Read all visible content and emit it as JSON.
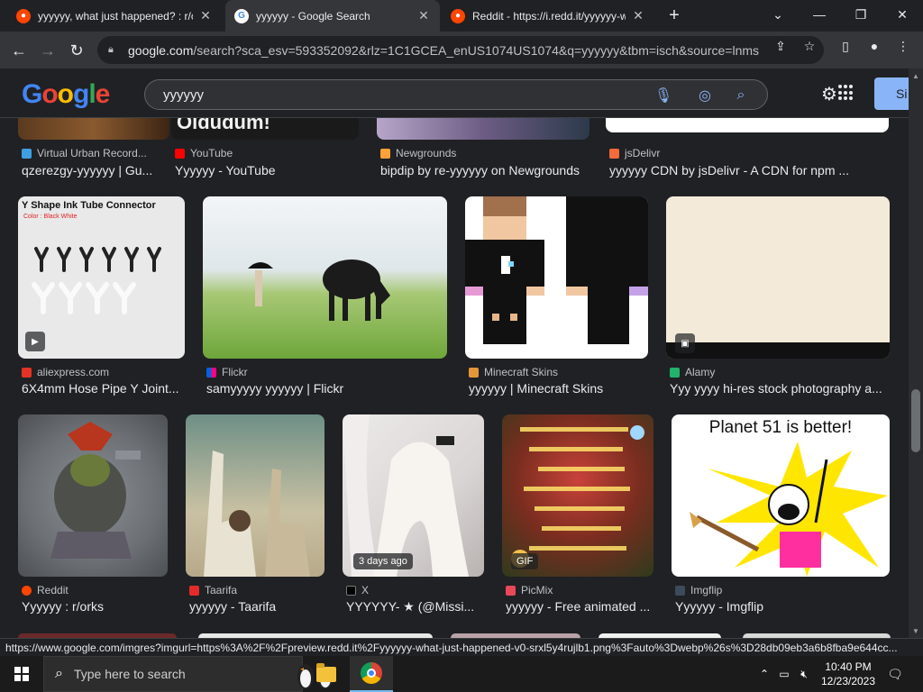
{
  "tabs": [
    {
      "title": "yyyyyy, what just happened? : r/c",
      "favicon": "reddit-icon",
      "active": false
    },
    {
      "title": "yyyyyy - Google Search",
      "favicon": "google-icon",
      "active": true
    },
    {
      "title": "Reddit - https://i.redd.it/yyyyyy-w",
      "favicon": "reddit-icon",
      "active": false
    }
  ],
  "toolbar": {
    "url_host": "google.com",
    "url_rest": "/search?sca_esv=593352092&rlz=1C1GCEA_enUS1074US1074&q=yyyyyy&tbm=isch&source=lnms..."
  },
  "google": {
    "logo_letters": [
      "G",
      "o",
      "o",
      "g",
      "l",
      "e"
    ],
    "query": "yyyyyy",
    "signin_label": "Si"
  },
  "results": {
    "row0": [
      {
        "source": "Virtual Urban Record...",
        "title": "qzerezgy-yyyyyy | Gu...",
        "thumb_text": ""
      },
      {
        "source": "YouTube",
        "title": "Yyyyyy - YouTube",
        "thumb_text": "Oldudum!"
      },
      {
        "source": "Newgrounds",
        "title": "bipdip by re-yyyyyy on Newgrounds",
        "thumb_text": ""
      },
      {
        "source": "jsDelivr",
        "title": "yyyyyy CDN by jsDelivr - A CDN for npm ...",
        "thumb_text": ""
      }
    ],
    "row1": [
      {
        "source": "aliexpress.com",
        "title": "6X4mm Hose Pipe Y Joint...",
        "thumb_text": "Y Shape Ink Tube Connector",
        "thumb_sub": "Color : Black White"
      },
      {
        "source": "Flickr",
        "title": "samyyyyy yyyyyy | Flickr"
      },
      {
        "source": "Minecraft Skins",
        "title": "yyyyyy | Minecraft Skins"
      },
      {
        "source": "Alamy",
        "title": "Yyy yyyy hi-res stock photography a..."
      }
    ],
    "row2": [
      {
        "source": "Reddit",
        "title": "Yyyyyy : r/orks"
      },
      {
        "source": "Taarifa",
        "title": "yyyyyy - Taarifa"
      },
      {
        "source": "X",
        "title": "YYYYYY- ★ (@Missi...",
        "badge": "3 days ago"
      },
      {
        "source": "PicMix",
        "title": "yyyyyy - Free animated ...",
        "badge": "GIF"
      },
      {
        "source": "Imgflip",
        "title": "Yyyyyy - Imgflip",
        "thumb_text": "Planet 51 is better!"
      }
    ]
  },
  "status_url": "https://www.google.com/imgres?imgurl=https%3A%2F%2Fpreview.redd.it%2Fyyyyyy-what-just-happened-v0-srxl5y4rujlb1.png%3Fauto%3Dwebp%26s%3D28db09eb3a6b8fba9e644cc...",
  "taskbar": {
    "search_placeholder": "Type here to search",
    "time": "10:40 PM",
    "date": "12/23/2023"
  },
  "colors": {
    "page_bg": "#202124",
    "toolbar_bg": "#35363a",
    "accent_blue": "#8ab4f8"
  }
}
